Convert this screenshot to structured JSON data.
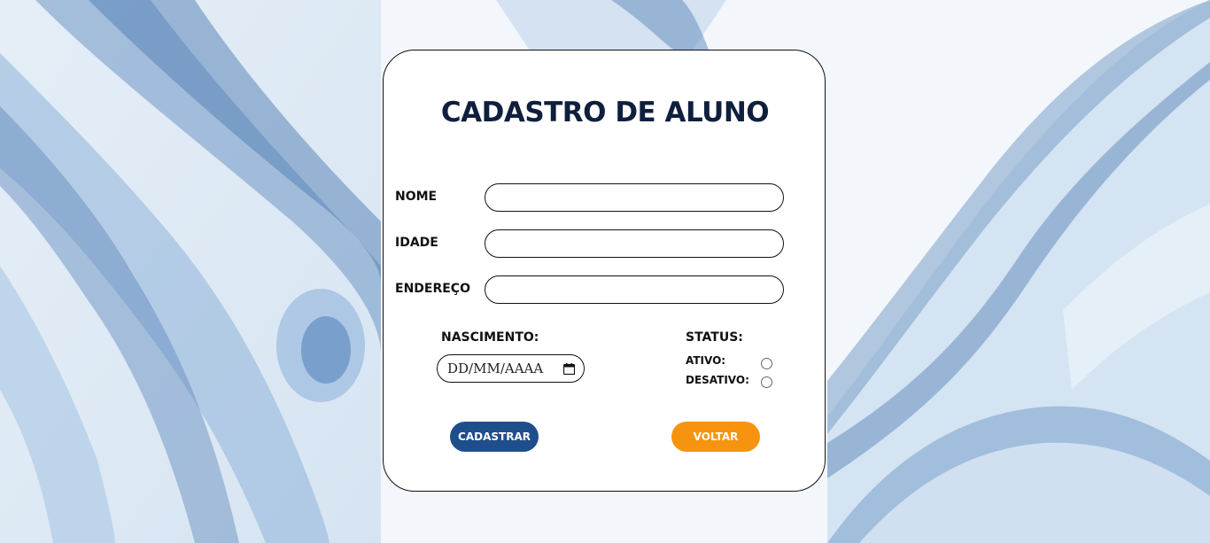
{
  "form": {
    "title": "CADASTRO DE ALUNO",
    "fields": {
      "nome": {
        "label": "NOME",
        "value": "",
        "placeholder": ""
      },
      "idade": {
        "label": "IDADE",
        "value": "",
        "placeholder": ""
      },
      "endereco": {
        "label": "ENDEREÇO",
        "value": "",
        "placeholder": ""
      }
    },
    "nascimento": {
      "label": "NASCIMENTO:",
      "placeholder": "DD/MM/AAAA",
      "icon": "calendar-icon"
    },
    "status": {
      "label": "STATUS:",
      "options": [
        {
          "label": "ATIVO:",
          "checked": false
        },
        {
          "label": "DESATIVO:",
          "checked": false
        }
      ]
    },
    "buttons": {
      "submit_label": "CADASTRAR",
      "back_label": "VOLTAR"
    }
  },
  "colors": {
    "title": "#0f1f3d",
    "submit_button": "#1f4e8c",
    "back_button": "#f7940f",
    "background_accent": "#7fa6cf"
  }
}
